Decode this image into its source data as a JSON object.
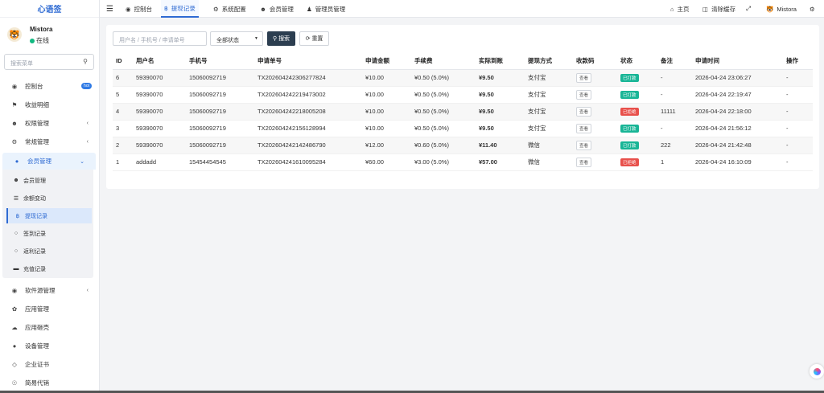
{
  "app": {
    "logo": "心语签"
  },
  "user": {
    "name": "Mistora",
    "status": "在线"
  },
  "sidebar": {
    "search_placeholder": "搜索菜单",
    "items": [
      {
        "label": "控制台",
        "badge": "hot"
      },
      {
        "label": "收益明细"
      },
      {
        "label": "权限管理"
      },
      {
        "label": "常规管理"
      },
      {
        "label": "会员管理"
      },
      {
        "label": "软件源管理"
      },
      {
        "label": "应用管理"
      },
      {
        "label": "应用砸壳"
      },
      {
        "label": "设备管理"
      },
      {
        "label": "企业证书"
      },
      {
        "label": "简易代销"
      }
    ],
    "submenu": [
      {
        "label": "会员管理"
      },
      {
        "label": "余额变动"
      },
      {
        "label": "提现记录"
      },
      {
        "label": "签到记录"
      },
      {
        "label": "返利记录"
      },
      {
        "label": "充值记录"
      }
    ]
  },
  "topbar": {
    "tabs": [
      {
        "label": "控制台"
      },
      {
        "label": "提现记录"
      },
      {
        "label": "系统配置"
      },
      {
        "label": "会员管理"
      },
      {
        "label": "管理员管理"
      }
    ],
    "home": "主页",
    "clear_cache": "清除缓存",
    "username": "Mistora"
  },
  "filter": {
    "placeholder": "用户名 / 手机号 / 申请单号",
    "status_select": "全部状态",
    "search_btn": "搜索",
    "reset_btn": "重置"
  },
  "table": {
    "columns": [
      "ID",
      "用户名",
      "手机号",
      "申请单号",
      "申请金额",
      "手续费",
      "实际到账",
      "提现方式",
      "收款码",
      "状态",
      "备注",
      "申请时间",
      "操作"
    ],
    "qr_label": "查看",
    "rows": [
      {
        "id": "6",
        "user": "59390070",
        "phone": "15060092719",
        "order": "TX20260424230627782​4",
        "amount": "¥10.00",
        "fee": "¥0.50 (5.0%)",
        "actual": "¥9.50",
        "method": "支付宝",
        "status": "已打款",
        "status_color": "#18b596",
        "note": "-",
        "time": "2026-04-24 23:06:27",
        "op": "-"
      },
      {
        "id": "5",
        "user": "59390070",
        "phone": "15060092719",
        "order": "TX202604242219473002",
        "amount": "¥10.00",
        "fee": "¥0.50 (5.0%)",
        "actual": "¥9.50",
        "method": "支付宝",
        "status": "已打款",
        "status_color": "#18b596",
        "note": "-",
        "time": "2026-04-24 22:19:47",
        "op": "-"
      },
      {
        "id": "4",
        "user": "59390070",
        "phone": "15060092719",
        "order": "TX202604242218005208",
        "amount": "¥10.00",
        "fee": "¥0.50 (5.0%)",
        "actual": "¥9.50",
        "method": "支付宝",
        "status": "已拒绝",
        "status_color": "#e8504b",
        "note": "11111",
        "time": "2026-04-24 22:18:00",
        "op": "-"
      },
      {
        "id": "3",
        "user": "59390070",
        "phone": "15060092719",
        "order": "TX202604242156128994",
        "amount": "¥10.00",
        "fee": "¥0.50 (5.0%)",
        "actual": "¥9.50",
        "method": "支付宝",
        "status": "已打款",
        "status_color": "#18b596",
        "note": "-",
        "time": "2026-04-24 21:56:12",
        "op": "-"
      },
      {
        "id": "2",
        "user": "59390070",
        "phone": "15060092719",
        "order": "TX202604242142486790",
        "amount": "¥12.00",
        "fee": "¥0.60 (5.0%)",
        "actual": "¥11.40",
        "method": "微信",
        "status": "已打款",
        "status_color": "#18b596",
        "note": "222",
        "time": "2026-04-24 21:42:48",
        "op": "-"
      },
      {
        "id": "1",
        "user": "addadd",
        "phone": "15454454545",
        "order": "TX202604241610095284",
        "amount": "¥60.00",
        "fee": "¥3.00 (5.0%)",
        "actual": "¥57.00",
        "method": "微信",
        "status": "已拒绝",
        "status_color": "#e8504b",
        "note": "1",
        "time": "2026-04-24 16:10:09",
        "op": "-"
      }
    ]
  }
}
